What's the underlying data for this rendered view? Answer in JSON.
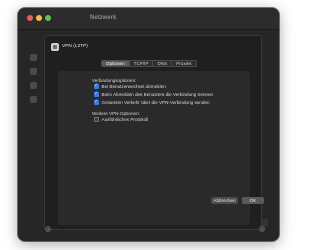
{
  "window": {
    "title": "Netzwerk"
  },
  "sheet": {
    "title": "VPN (L2TP)",
    "tabs": [
      {
        "label": "Optionen",
        "active": true
      },
      {
        "label": "TCP/IP",
        "active": false
      },
      {
        "label": "DNS",
        "active": false
      },
      {
        "label": "Proxies",
        "active": false
      }
    ],
    "section1_label": "Verbindungsoptionen:",
    "options": [
      {
        "label": "Bei Benutzerwechsel abmelden",
        "checked": true
      },
      {
        "label": "Beim Abmelden des Benutzers die Verbindung trennen",
        "checked": true
      },
      {
        "label": "Gesamten Verkehr über die VPN-Verbindung senden",
        "checked": true
      }
    ],
    "section2_label": "Weitere VPN-Optionen:",
    "more_options": [
      {
        "label": "Ausführliches Protokoll",
        "checked": false
      }
    ],
    "cancel_label": "Abbrechen",
    "ok_label": "OK"
  },
  "help_label": "?",
  "colors": {
    "accent": "#2d7df6",
    "window_bg": "#262626",
    "sheet_bg": "#1f1f1f"
  }
}
